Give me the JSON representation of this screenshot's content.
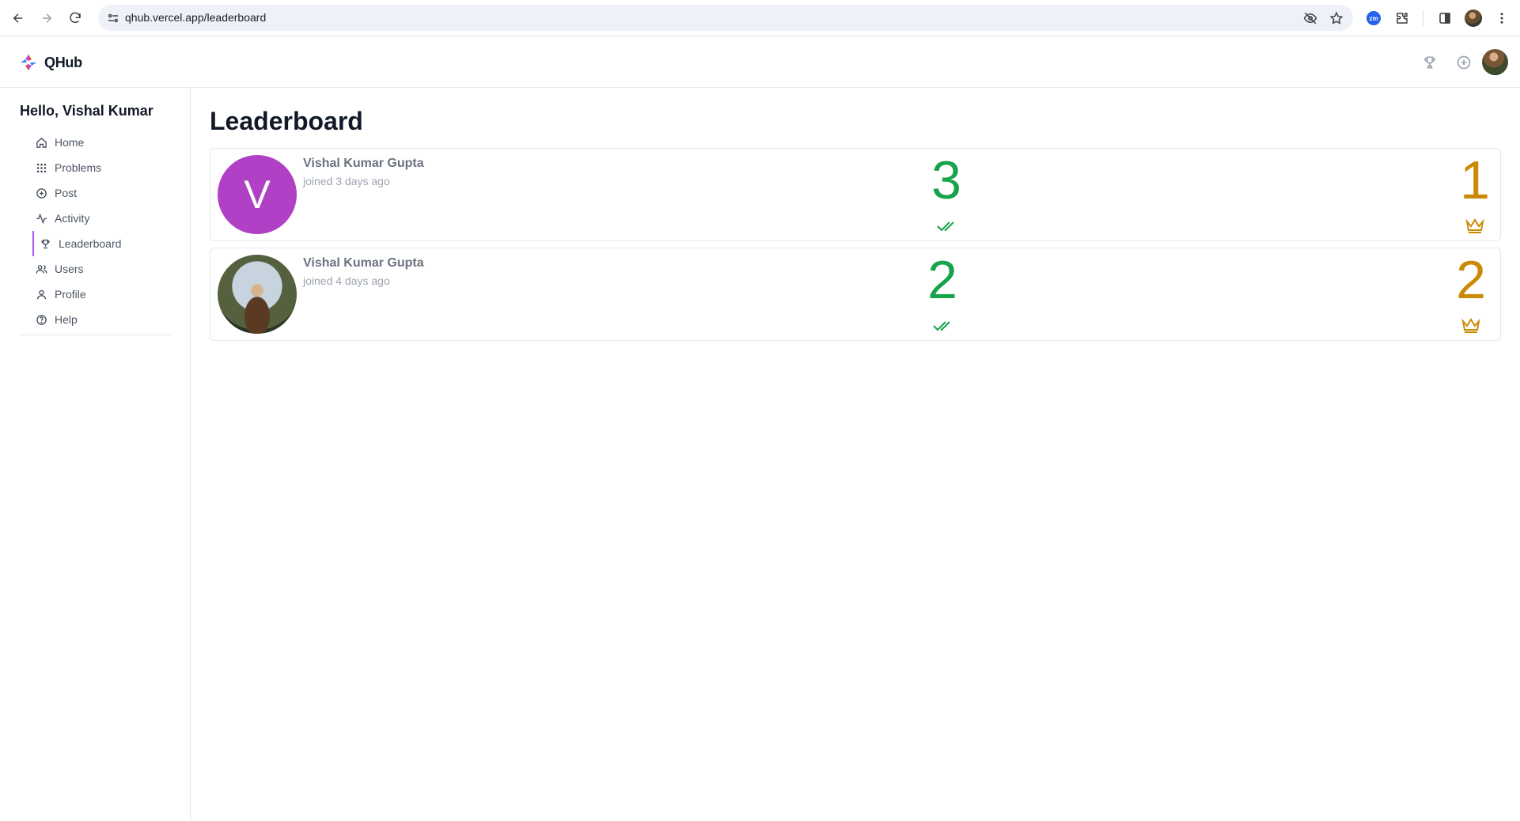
{
  "browser": {
    "url": "qhub.vercel.app/leaderboard",
    "extension_badge": "zm"
  },
  "header": {
    "logo_text": "QHub"
  },
  "sidebar": {
    "greeting": "Hello, Vishal Kumar",
    "items": [
      {
        "label": "Home",
        "icon": "home-icon"
      },
      {
        "label": "Problems",
        "icon": "grid-icon"
      },
      {
        "label": "Post",
        "icon": "plus-circle-icon"
      },
      {
        "label": "Activity",
        "icon": "activity-icon"
      },
      {
        "label": "Leaderboard",
        "icon": "trophy-icon",
        "active": true
      },
      {
        "label": "Users",
        "icon": "users-icon"
      },
      {
        "label": "Profile",
        "icon": "user-icon"
      },
      {
        "label": "Help",
        "icon": "help-circle-icon"
      }
    ]
  },
  "main": {
    "title": "Leaderboard",
    "entries": [
      {
        "name": "Vishal Kumar Gupta",
        "joined": "joined 3 days ago",
        "avatar_letter": "V",
        "solved": "3",
        "rank": "1"
      },
      {
        "name": "Vishal Kumar Gupta",
        "joined": "joined 4 days ago",
        "avatar_letter": "",
        "solved": "2",
        "rank": "2"
      }
    ]
  },
  "colors": {
    "accent": "#a855f7",
    "solved": "#16a34a",
    "rank": "#ca8a04",
    "avatar_bg": "#b041c6"
  }
}
